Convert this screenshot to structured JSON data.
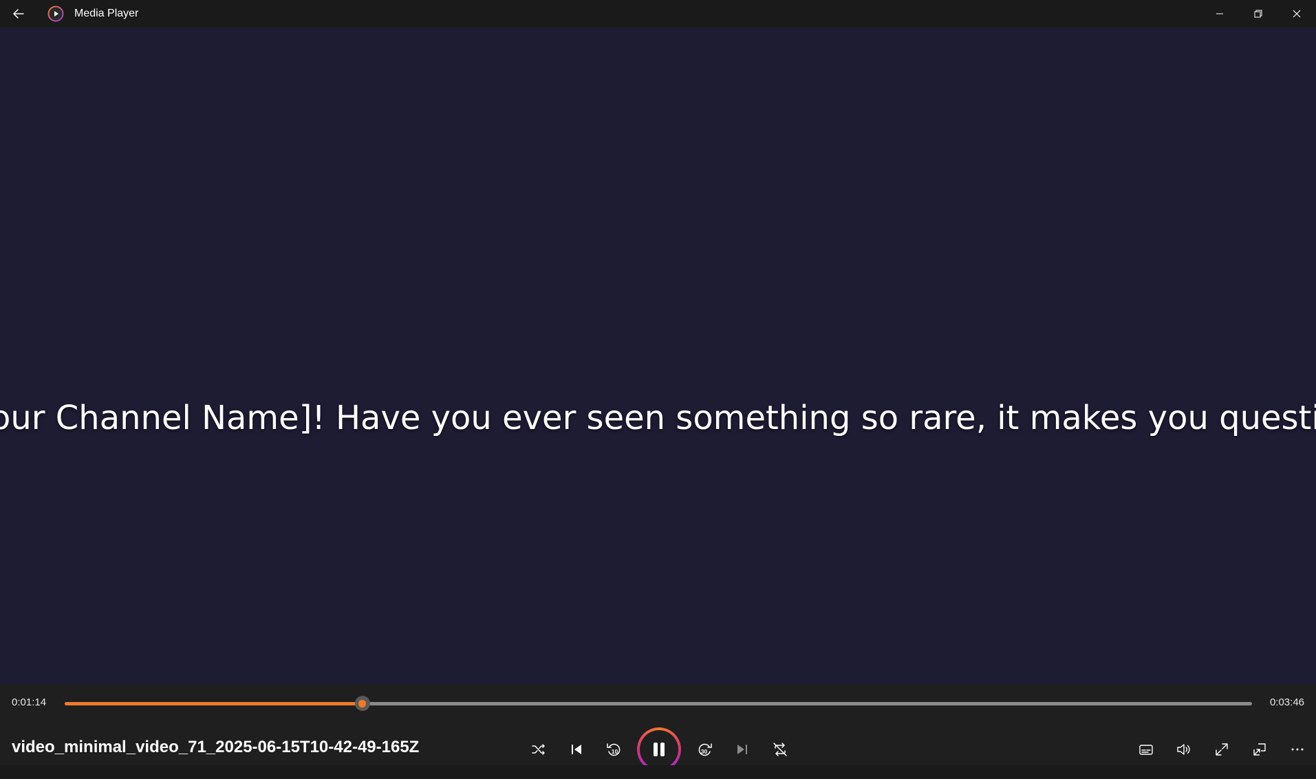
{
  "window": {
    "title": "Media Player"
  },
  "video": {
    "caption": "our Channel Name]! Have you ever seen something so rare, it makes you questio"
  },
  "playback": {
    "current_time": "0:01:14",
    "total_time": "0:03:46",
    "progress_fraction": 0.2506,
    "media_title": "video_minimal_video_71_2025-06-15T10-42-49-165Z",
    "state": "playing"
  },
  "icons": {
    "back": "back-arrow-icon",
    "logo": "media-player-logo-icon",
    "minimize": "minimize-icon",
    "restore": "restore-icon",
    "close": "close-icon",
    "shuffle": "shuffle-icon",
    "previous": "previous-track-icon",
    "skip_back": "skip-back-10-icon",
    "pause": "pause-icon",
    "skip_forward": "skip-forward-30-icon",
    "next": "next-track-icon",
    "repeat": "repeat-off-icon",
    "captions": "captions-icon",
    "volume": "volume-icon",
    "fullscreen": "fullscreen-icon",
    "miniplayer": "mini-player-icon",
    "more": "more-icon"
  },
  "skip_back_label": "10",
  "skip_forward_label": "30",
  "colors": {
    "accent": "#f07a2a",
    "video_bg": "#1e1c33",
    "controls_bg": "#1f1f1f"
  }
}
